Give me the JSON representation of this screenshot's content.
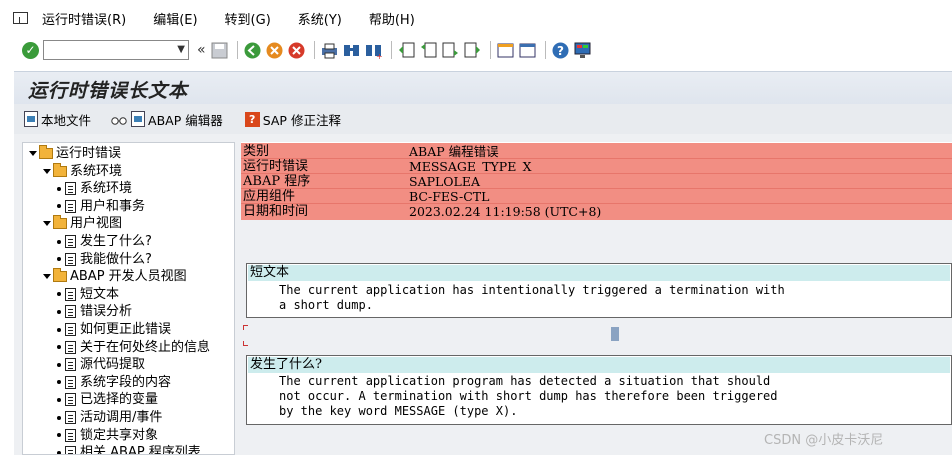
{
  "menubar": {
    "items": [
      "运行时错误(R)",
      "编辑(E)",
      "转到(G)",
      "系统(Y)",
      "帮助(H)"
    ]
  },
  "toolbar": {
    "command_field_value": ""
  },
  "page_title": "运行时错误长文本",
  "app_toolbar": {
    "local_file": "本地文件",
    "abap_editor": "ABAP 编辑器",
    "sap_note": "SAP 修正注释"
  },
  "tree": {
    "items": [
      {
        "label": "运行时错误",
        "level": 0,
        "kind": "folder"
      },
      {
        "label": "系统环境",
        "level": 1,
        "kind": "folder"
      },
      {
        "label": "系统环境",
        "level": 2,
        "kind": "page"
      },
      {
        "label": "用户和事务",
        "level": 2,
        "kind": "page"
      },
      {
        "label": "用户视图",
        "level": 1,
        "kind": "folder"
      },
      {
        "label": "发生了什么?",
        "level": 2,
        "kind": "page"
      },
      {
        "label": "我能做什么?",
        "level": 2,
        "kind": "page"
      },
      {
        "label": "ABAP 开发人员视图",
        "level": 1,
        "kind": "folder"
      },
      {
        "label": "短文本",
        "level": 2,
        "kind": "page"
      },
      {
        "label": "错误分析",
        "level": 2,
        "kind": "page"
      },
      {
        "label": "如何更正此错误",
        "level": 2,
        "kind": "page"
      },
      {
        "label": "关于在何处终止的信息",
        "level": 2,
        "kind": "page"
      },
      {
        "label": "源代码提取",
        "level": 2,
        "kind": "page"
      },
      {
        "label": "系统字段的内容",
        "level": 2,
        "kind": "page"
      },
      {
        "label": "已选择的变量",
        "level": 2,
        "kind": "page"
      },
      {
        "label": "活动调用/事件",
        "level": 2,
        "kind": "page"
      },
      {
        "label": "锁定共享对象",
        "level": 2,
        "kind": "page"
      },
      {
        "label": "相关 ABAP 程序列表",
        "level": 2,
        "kind": "page"
      }
    ]
  },
  "header_table": {
    "rows": [
      {
        "key": "类别",
        "value": "ABAP 编程错误"
      },
      {
        "key": "运行时错误",
        "value": "MESSAGE_TYPE_X"
      },
      {
        "key": "ABAP 程序",
        "value": "SAPLOLEA"
      },
      {
        "key": "应用组件",
        "value": "BC-FES-CTL"
      },
      {
        "key": "日期和时间",
        "value": "2023.02.24 11:19:58 (UTC+8)"
      }
    ]
  },
  "short_text": {
    "title": "短文本",
    "lines": [
      "The current application has intentionally triggered a termination with",
      "a short dump."
    ]
  },
  "what_happened": {
    "title": "发生了什么?",
    "lines": [
      "The current application program has detected a situation that should",
      "not occur. A termination with short dump has therefore been triggered",
      "by the key word MESSAGE (type X)."
    ]
  },
  "watermark": "CSDN @小皮卡沃尼"
}
